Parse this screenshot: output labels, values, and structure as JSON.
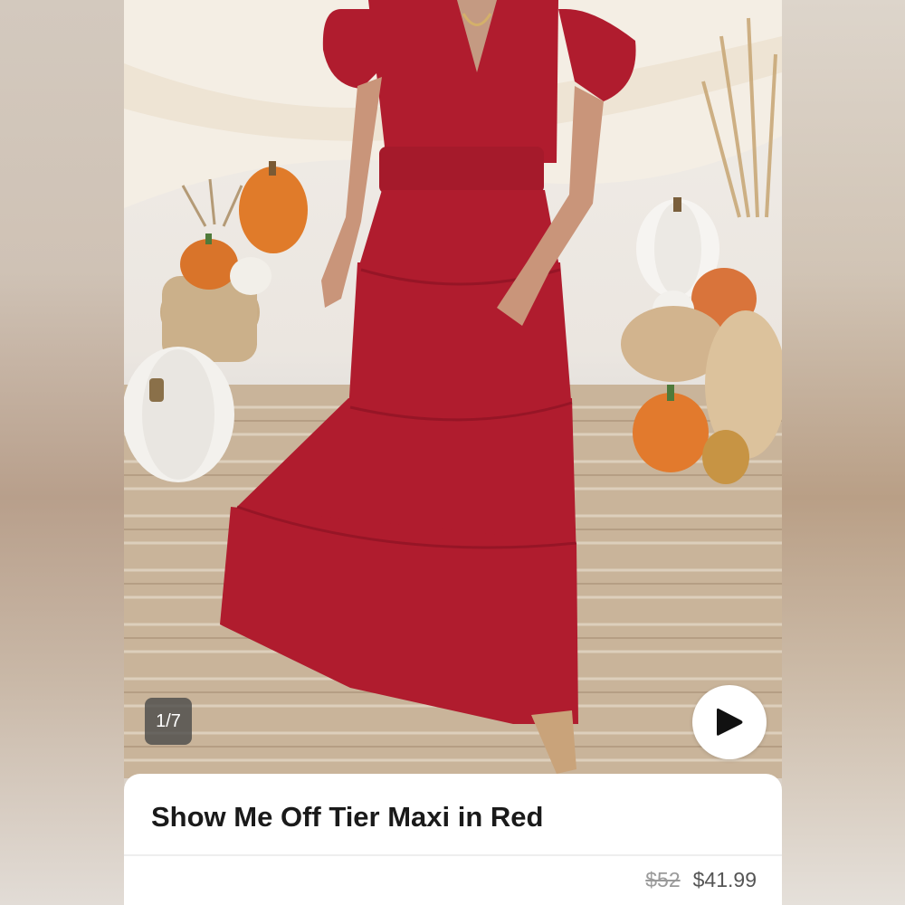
{
  "listing": {
    "title": "Show Me Off Tier Maxi in Red",
    "original_price": "$52",
    "sale_price": "$41.99"
  },
  "gallery": {
    "counter": "1/7",
    "play_icon": "play-icon"
  },
  "colors": {
    "dress": "#b01c2e",
    "card": "#ffffff",
    "counter_bg": "#464646"
  }
}
